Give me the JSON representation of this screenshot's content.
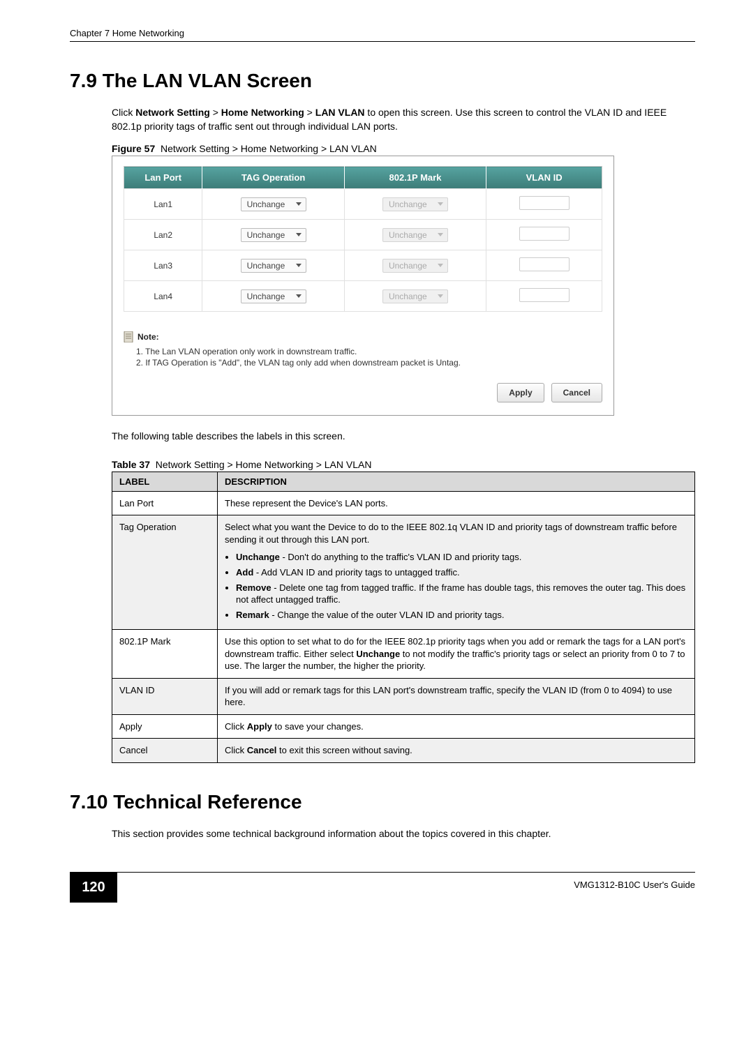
{
  "running_header": "Chapter 7 Home Networking",
  "section79": {
    "heading": "7.9  The LAN VLAN Screen",
    "intro_pre": "Click ",
    "path1": "Network Setting",
    "sep1": " > ",
    "path2": "Home Networking",
    "sep2": " > ",
    "path3": "LAN VLAN",
    "intro_post": " to open this screen. Use this screen to control the VLAN ID and IEEE 802.1p priority tags of traffic sent out through individual LAN ports.",
    "figure_label": "Figure 57",
    "figure_text": "Network Setting > Home Networking > LAN VLAN"
  },
  "screenshot": {
    "headers": {
      "col1": "Lan Port",
      "col2": "TAG Operation",
      "col3": "802.1P Mark",
      "col4": "VLAN ID"
    },
    "rows": [
      {
        "port": "Lan1",
        "tag_op": "Unchange",
        "mark": "Unchange"
      },
      {
        "port": "Lan2",
        "tag_op": "Unchange",
        "mark": "Unchange"
      },
      {
        "port": "Lan3",
        "tag_op": "Unchange",
        "mark": "Unchange"
      },
      {
        "port": "Lan4",
        "tag_op": "Unchange",
        "mark": "Unchange"
      }
    ],
    "note_label": "Note:",
    "note_lines": [
      "1. The Lan VLAN operation only work in downstream traffic.",
      "2. If TAG Operation is \"Add\", the VLAN tag only add when downstream packet is Untag."
    ],
    "apply_label": "Apply",
    "cancel_label": "Cancel"
  },
  "between_text": "The following table describes the labels in this screen.",
  "table37": {
    "caption_label": "Table 37",
    "caption_text": "Network Setting > Home Networking > LAN VLAN",
    "header_label": "LABEL",
    "header_desc": "DESCRIPTION",
    "rows": {
      "lan_port_label": "Lan Port",
      "lan_port_desc": "These represent the Device's LAN ports.",
      "tag_op_label": "Tag Operation",
      "tag_op_intro": "Select what you want the Device to do to the IEEE 802.1q VLAN ID and priority tags of downstream traffic before sending it out through this LAN port.",
      "ops": {
        "unchange_b": "Unchange",
        "unchange_t": " - Don't do anything to the traffic's VLAN ID and priority tags.",
        "add_b": "Add",
        "add_t": " - Add VLAN ID and priority tags to untagged traffic.",
        "remove_b": "Remove",
        "remove_t": " - Delete one tag from tagged traffic. If the frame has double tags, this removes the outer tag. This does not affect untagged traffic.",
        "remark_b": "Remark",
        "remark_t": " - Change the value of the outer VLAN ID and priority tags."
      },
      "mark_label": "802.1P Mark",
      "mark_pre": "Use this option to set what to do for the IEEE 802.1p priority tags when you add or remark the tags for a LAN port's downstream traffic. Either select ",
      "mark_bold": "Unchange",
      "mark_post": " to not modify the traffic's priority tags or select an priority from 0 to 7 to use. The larger the number, the higher the priority.",
      "vlan_label": "VLAN ID",
      "vlan_desc": "If you will add or remark tags for this LAN port's downstream traffic, specify the VLAN ID (from 0 to 4094) to use here.",
      "apply_label": "Apply",
      "apply_pre": "Click ",
      "apply_bold": "Apply",
      "apply_post": " to save your changes.",
      "cancel_label": "Cancel",
      "cancel_pre": "Click ",
      "cancel_bold": "Cancel",
      "cancel_post": " to exit this screen without saving."
    }
  },
  "section710": {
    "heading": "7.10  Technical Reference",
    "body": "This section provides some technical background information about the topics covered in this chapter."
  },
  "footer": {
    "page_number": "120",
    "guide": "VMG1312-B10C User's Guide"
  }
}
